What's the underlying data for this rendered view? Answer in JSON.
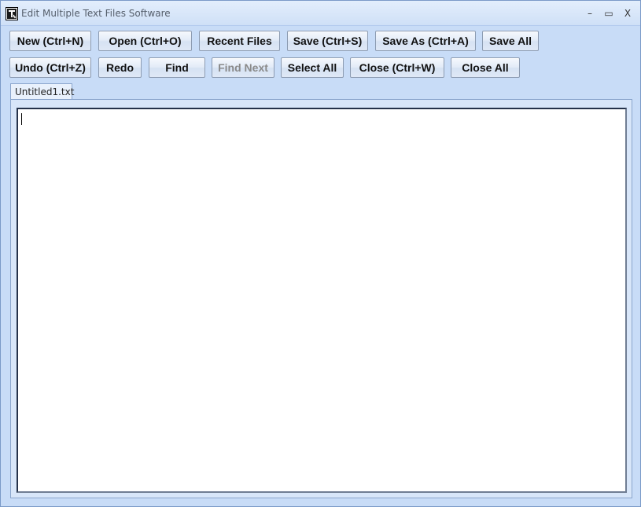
{
  "window": {
    "title": "Edit Multiple Text Files Software",
    "controls": {
      "minimize": "–",
      "maximize": "▭",
      "close": "X"
    }
  },
  "toolbar": {
    "row1": [
      {
        "label": "New (Ctrl+N)",
        "enabled": true
      },
      {
        "label": "Open (Ctrl+O)",
        "enabled": true
      },
      {
        "label": "Recent Files",
        "enabled": true
      },
      {
        "label": "Save (Ctrl+S)",
        "enabled": true
      },
      {
        "label": "Save As (Ctrl+A)",
        "enabled": true
      },
      {
        "label": "Save All",
        "enabled": true
      }
    ],
    "row2": [
      {
        "label": "Undo (Ctrl+Z)",
        "enabled": true
      },
      {
        "label": "Redo",
        "enabled": true
      },
      {
        "label": "Find",
        "enabled": true
      },
      {
        "label": "Find Next",
        "enabled": false
      },
      {
        "label": "Select All",
        "enabled": true
      },
      {
        "label": "Close (Ctrl+W)",
        "enabled": true
      },
      {
        "label": "Close All",
        "enabled": true
      }
    ]
  },
  "tabs": [
    {
      "label": "Untitled1.txt",
      "active": true
    }
  ],
  "editor": {
    "content": ""
  },
  "colors": {
    "window_bg": "#c8dcf7",
    "disabled_text": "#8a8a8a"
  }
}
